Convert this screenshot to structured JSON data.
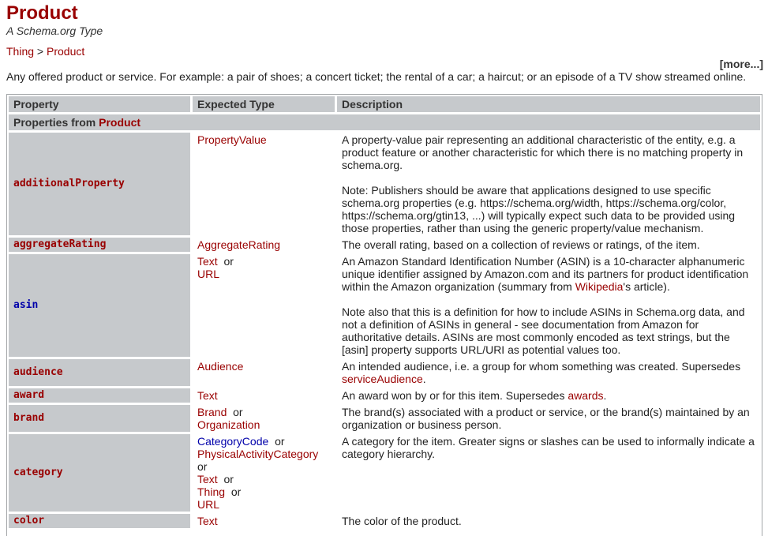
{
  "header": {
    "title": "Product",
    "subtitle": "A Schema.org Type",
    "breadcrumb": [
      {
        "label": "Thing"
      },
      {
        "separator": " > "
      },
      {
        "label": "Product"
      }
    ],
    "more_link": "[more...]",
    "description": "Any offered product or service. For example: a pair of shoes; a concert ticket; the rental of a car; a haircut; or an episode of a TV show streamed online."
  },
  "table": {
    "columns": [
      "Property",
      "Expected Type",
      "Description"
    ],
    "section": {
      "prefix": "Properties from ",
      "type_link": "Product"
    },
    "or_word": "or",
    "rows": [
      {
        "property": "additionalProperty",
        "types": [
          "PropertyValue"
        ],
        "description": [
          "A property-value pair representing an additional characteristic of the entity, e.g. a product feature or another characteristic for which there is no matching property in schema.org.",
          "Note: Publishers should be aware that applications designed to use specific schema.org properties (e.g. https://schema.org/width, https://schema.org/color, https://schema.org/gtin13, ...) will typically expect such data to be provided using those properties, rather than using the generic property/value mechanism."
        ]
      },
      {
        "property": "aggregateRating",
        "types": [
          "AggregateRating"
        ],
        "description": [
          "The overall rating, based on a collection of reviews or ratings, of the item."
        ]
      },
      {
        "property": "asin",
        "types": [
          "Text",
          "URL"
        ],
        "description_asin": {
          "p1_before": "An Amazon Standard Identification Number (ASIN) is a 10-character alphanumeric unique identifier assigned by Amazon.com and its partners for product identification within the Amazon organization (summary from ",
          "p1_link": "Wikipedia",
          "p1_after": "'s article).",
          "p2": "Note also that this is a definition for how to include ASINs in Schema.org data, and not a definition of ASINs in general - see documentation from Amazon for authoritative details. ASINs are most commonly encoded as text strings, but the [asin] property supports URL/URI as potential values too."
        }
      },
      {
        "property": "audience",
        "types": [
          "Audience"
        ],
        "desc_before": "An intended audience, i.e. a group for whom something was created. Supersedes ",
        "desc_link": "serviceAudience",
        "desc_after": "."
      },
      {
        "property": "award",
        "types": [
          "Text"
        ],
        "desc_before": "An award won by or for this item. Supersedes ",
        "desc_link": "awards",
        "desc_after": "."
      },
      {
        "property": "brand",
        "types": [
          "Brand",
          "Organization"
        ],
        "description": [
          "The brand(s) associated with a product or service, or the brand(s) maintained by an organization or business person."
        ]
      },
      {
        "property": "category",
        "types": [
          "CategoryCode",
          "PhysicalActivityCategory",
          "Text",
          "Thing",
          "URL"
        ],
        "description": [
          "A category for the item. Greater signs or slashes can be used to informally indicate a category hierarchy."
        ]
      },
      {
        "property": "color",
        "types": [
          "Text"
        ],
        "description": [
          "The color of the product."
        ]
      }
    ]
  }
}
